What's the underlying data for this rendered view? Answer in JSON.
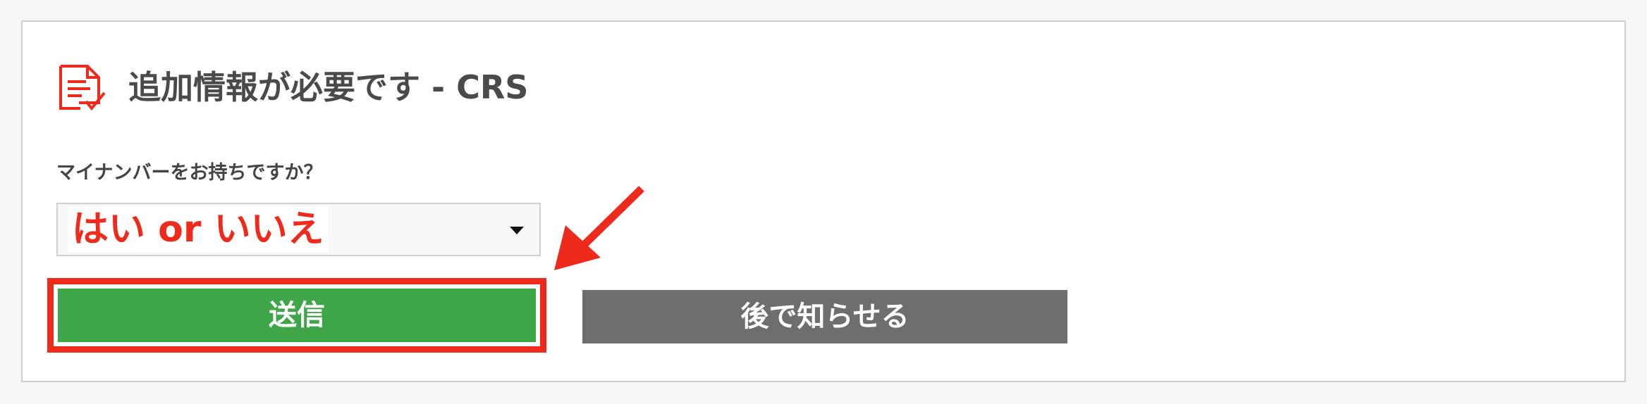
{
  "header": {
    "icon": "document-check-icon",
    "title": "追加情報が必要です - CRS"
  },
  "form": {
    "question_label": "マイナンバーをお持ちですか？",
    "select_annotation": "はい or いいえ",
    "select_caret_icon": "caret-down-icon"
  },
  "actions": {
    "submit_label": "送信",
    "later_label": "後で知らせる"
  },
  "annotation": {
    "arrow_icon": "red-arrow-icon"
  },
  "colors": {
    "accent_red": "#ee2a1c",
    "submit_green": "#3ea647",
    "later_gray": "#6e6e6e",
    "title_text": "#4a4a4a"
  }
}
